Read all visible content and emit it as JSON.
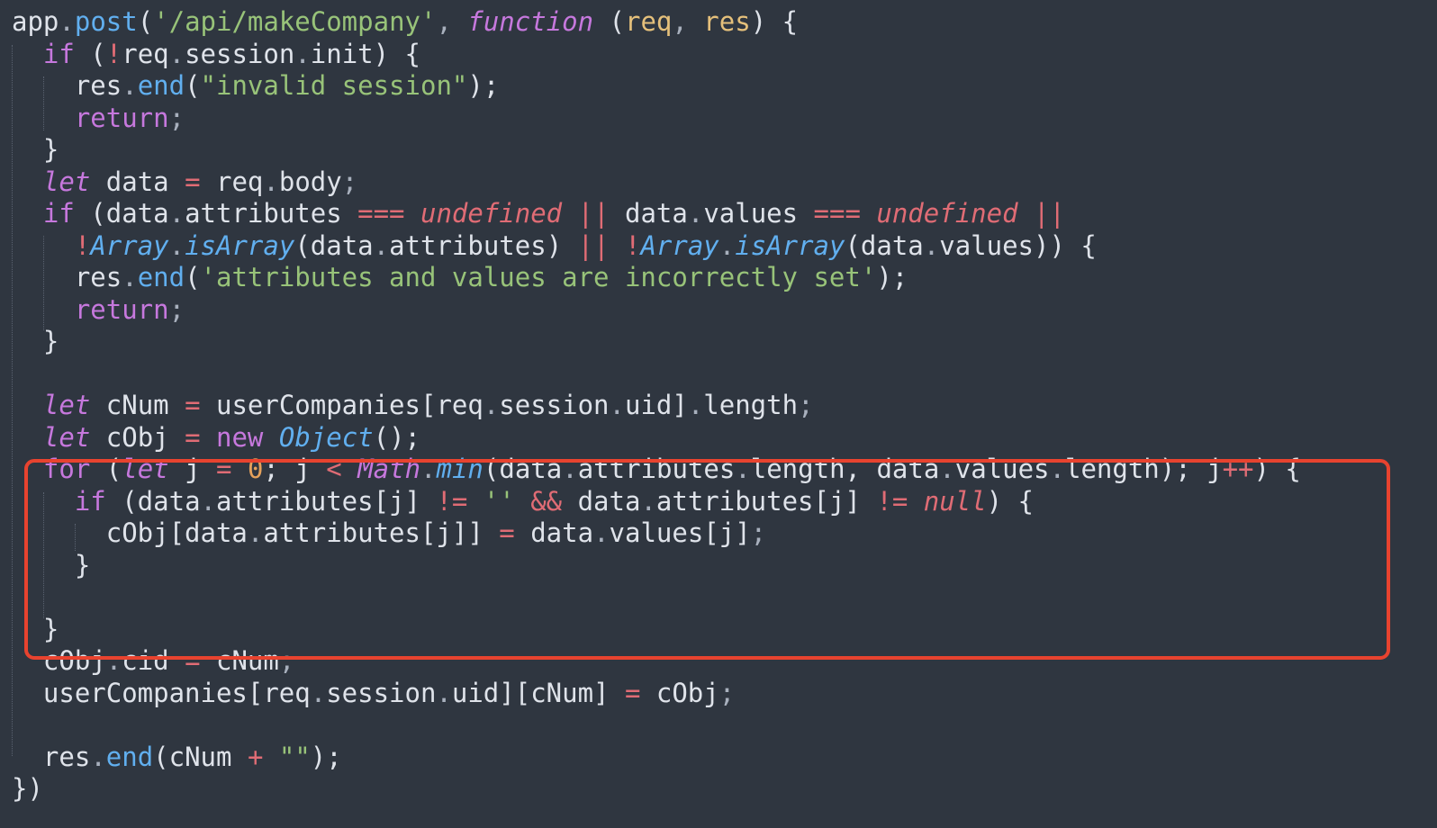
{
  "colors": {
    "background": "#2f3640",
    "plain": "#dfe3ea",
    "keyword": "#c678dd",
    "function": "#61afef",
    "string": "#98c379",
    "operator": "#e06c75",
    "param": "#e5c07b",
    "number": "#e5a15b",
    "punct": "#a8b0bd",
    "highlight_border": "#e8432f"
  },
  "code": {
    "lines": [
      [
        {
          "t": "app",
          "c": "plain"
        },
        {
          "t": ".",
          "c": "punct"
        },
        {
          "t": "post",
          "c": "function"
        },
        {
          "t": "(",
          "c": "plain"
        },
        {
          "t": "'/api/makeCompany'",
          "c": "string"
        },
        {
          "t": ", ",
          "c": "punct"
        },
        {
          "t": "function",
          "c": "keyword",
          "i": true
        },
        {
          "t": " (",
          "c": "plain"
        },
        {
          "t": "req",
          "c": "param"
        },
        {
          "t": ", ",
          "c": "punct"
        },
        {
          "t": "res",
          "c": "param"
        },
        {
          "t": ") {",
          "c": "plain"
        }
      ],
      [
        {
          "t": "  ",
          "c": "plain"
        },
        {
          "t": "if",
          "c": "keyword"
        },
        {
          "t": " (",
          "c": "plain"
        },
        {
          "t": "!",
          "c": "operator"
        },
        {
          "t": "req",
          "c": "plain"
        },
        {
          "t": ".",
          "c": "punct"
        },
        {
          "t": "session",
          "c": "plain"
        },
        {
          "t": ".",
          "c": "punct"
        },
        {
          "t": "init",
          "c": "plain"
        },
        {
          "t": ") {",
          "c": "plain"
        }
      ],
      [
        {
          "t": "    res",
          "c": "plain"
        },
        {
          "t": ".",
          "c": "punct"
        },
        {
          "t": "end",
          "c": "function"
        },
        {
          "t": "(",
          "c": "plain"
        },
        {
          "t": "\"invalid session\"",
          "c": "string"
        },
        {
          "t": ");",
          "c": "plain"
        }
      ],
      [
        {
          "t": "    ",
          "c": "plain"
        },
        {
          "t": "return",
          "c": "keyword"
        },
        {
          "t": ";",
          "c": "punct"
        }
      ],
      [
        {
          "t": "  }",
          "c": "plain"
        }
      ],
      [
        {
          "t": "  ",
          "c": "plain"
        },
        {
          "t": "let",
          "c": "keyword",
          "i": true
        },
        {
          "t": " data ",
          "c": "plain"
        },
        {
          "t": "=",
          "c": "operator"
        },
        {
          "t": " req",
          "c": "plain"
        },
        {
          "t": ".",
          "c": "punct"
        },
        {
          "t": "body",
          "c": "plain"
        },
        {
          "t": ";",
          "c": "punct"
        }
      ],
      [
        {
          "t": "  ",
          "c": "plain"
        },
        {
          "t": "if",
          "c": "keyword"
        },
        {
          "t": " (data",
          "c": "plain"
        },
        {
          "t": ".",
          "c": "punct"
        },
        {
          "t": "attributes ",
          "c": "plain"
        },
        {
          "t": "===",
          "c": "operator"
        },
        {
          "t": " ",
          "c": "plain"
        },
        {
          "t": "undefined",
          "c": "operator",
          "i": true
        },
        {
          "t": " ",
          "c": "plain"
        },
        {
          "t": "||",
          "c": "operator"
        },
        {
          "t": " data",
          "c": "plain"
        },
        {
          "t": ".",
          "c": "punct"
        },
        {
          "t": "values ",
          "c": "plain"
        },
        {
          "t": "===",
          "c": "operator"
        },
        {
          "t": " ",
          "c": "plain"
        },
        {
          "t": "undefined",
          "c": "operator",
          "i": true
        },
        {
          "t": " ",
          "c": "plain"
        },
        {
          "t": "||",
          "c": "operator"
        }
      ],
      [
        {
          "t": "    ",
          "c": "plain"
        },
        {
          "t": "!",
          "c": "operator"
        },
        {
          "t": "Array",
          "c": "function",
          "i": true
        },
        {
          "t": ".",
          "c": "punct"
        },
        {
          "t": "isArray",
          "c": "function",
          "i": true
        },
        {
          "t": "(data",
          "c": "plain"
        },
        {
          "t": ".",
          "c": "punct"
        },
        {
          "t": "attributes) ",
          "c": "plain"
        },
        {
          "t": "||",
          "c": "operator"
        },
        {
          "t": " ",
          "c": "plain"
        },
        {
          "t": "!",
          "c": "operator"
        },
        {
          "t": "Array",
          "c": "function",
          "i": true
        },
        {
          "t": ".",
          "c": "punct"
        },
        {
          "t": "isArray",
          "c": "function",
          "i": true
        },
        {
          "t": "(data",
          "c": "plain"
        },
        {
          "t": ".",
          "c": "punct"
        },
        {
          "t": "values)) {",
          "c": "plain"
        }
      ],
      [
        {
          "t": "    res",
          "c": "plain"
        },
        {
          "t": ".",
          "c": "punct"
        },
        {
          "t": "end",
          "c": "function"
        },
        {
          "t": "(",
          "c": "plain"
        },
        {
          "t": "'attributes and values are incorrectly set'",
          "c": "string"
        },
        {
          "t": ");",
          "c": "plain"
        }
      ],
      [
        {
          "t": "    ",
          "c": "plain"
        },
        {
          "t": "return",
          "c": "keyword"
        },
        {
          "t": ";",
          "c": "punct"
        }
      ],
      [
        {
          "t": "  }",
          "c": "plain"
        }
      ],
      [],
      [
        {
          "t": "  ",
          "c": "plain"
        },
        {
          "t": "let",
          "c": "keyword",
          "i": true
        },
        {
          "t": " cNum ",
          "c": "plain"
        },
        {
          "t": "=",
          "c": "operator"
        },
        {
          "t": " userCompanies[req",
          "c": "plain"
        },
        {
          "t": ".",
          "c": "punct"
        },
        {
          "t": "session",
          "c": "plain"
        },
        {
          "t": ".",
          "c": "punct"
        },
        {
          "t": "uid]",
          "c": "plain"
        },
        {
          "t": ".",
          "c": "punct"
        },
        {
          "t": "length",
          "c": "plain"
        },
        {
          "t": ";",
          "c": "punct"
        }
      ],
      [
        {
          "t": "  ",
          "c": "plain"
        },
        {
          "t": "let",
          "c": "keyword",
          "i": true
        },
        {
          "t": " cObj ",
          "c": "plain"
        },
        {
          "t": "=",
          "c": "operator"
        },
        {
          "t": " ",
          "c": "plain"
        },
        {
          "t": "new",
          "c": "keyword"
        },
        {
          "t": " ",
          "c": "plain"
        },
        {
          "t": "Object",
          "c": "function",
          "i": true
        },
        {
          "t": "();",
          "c": "plain"
        }
      ],
      [
        {
          "t": "  ",
          "c": "plain"
        },
        {
          "t": "for",
          "c": "keyword"
        },
        {
          "t": " (",
          "c": "plain"
        },
        {
          "t": "let",
          "c": "keyword",
          "i": true
        },
        {
          "t": " j ",
          "c": "plain"
        },
        {
          "t": "=",
          "c": "operator"
        },
        {
          "t": " ",
          "c": "plain"
        },
        {
          "t": "0",
          "c": "number"
        },
        {
          "t": "; j ",
          "c": "plain"
        },
        {
          "t": "<",
          "c": "operator"
        },
        {
          "t": " ",
          "c": "plain"
        },
        {
          "t": "Math",
          "c": "keyword",
          "i": true
        },
        {
          "t": ".",
          "c": "punct"
        },
        {
          "t": "min",
          "c": "function",
          "i": true
        },
        {
          "t": "(data",
          "c": "plain"
        },
        {
          "t": ".",
          "c": "punct"
        },
        {
          "t": "attributes",
          "c": "plain"
        },
        {
          "t": ".",
          "c": "punct"
        },
        {
          "t": "length, data",
          "c": "plain"
        },
        {
          "t": ".",
          "c": "punct"
        },
        {
          "t": "values",
          "c": "plain"
        },
        {
          "t": ".",
          "c": "punct"
        },
        {
          "t": "length); j",
          "c": "plain"
        },
        {
          "t": "++",
          "c": "operator"
        },
        {
          "t": ") {",
          "c": "plain"
        }
      ],
      [
        {
          "t": "    ",
          "c": "plain"
        },
        {
          "t": "if",
          "c": "keyword"
        },
        {
          "t": " (data",
          "c": "plain"
        },
        {
          "t": ".",
          "c": "punct"
        },
        {
          "t": "attributes[j] ",
          "c": "plain"
        },
        {
          "t": "!=",
          "c": "operator"
        },
        {
          "t": " ",
          "c": "plain"
        },
        {
          "t": "''",
          "c": "string"
        },
        {
          "t": " ",
          "c": "plain"
        },
        {
          "t": "&&",
          "c": "operator"
        },
        {
          "t": " data",
          "c": "plain"
        },
        {
          "t": ".",
          "c": "punct"
        },
        {
          "t": "attributes[j] ",
          "c": "plain"
        },
        {
          "t": "!=",
          "c": "operator"
        },
        {
          "t": " ",
          "c": "plain"
        },
        {
          "t": "null",
          "c": "operator",
          "i": true
        },
        {
          "t": ") {",
          "c": "plain"
        }
      ],
      [
        {
          "t": "      cObj[data",
          "c": "plain"
        },
        {
          "t": ".",
          "c": "punct"
        },
        {
          "t": "attributes[j]] ",
          "c": "plain"
        },
        {
          "t": "=",
          "c": "operator"
        },
        {
          "t": " data",
          "c": "plain"
        },
        {
          "t": ".",
          "c": "punct"
        },
        {
          "t": "values[j]",
          "c": "plain"
        },
        {
          "t": ";",
          "c": "punct"
        }
      ],
      [
        {
          "t": "    }",
          "c": "plain"
        }
      ],
      [],
      [
        {
          "t": "  }",
          "c": "plain"
        }
      ],
      [
        {
          "t": "  cObj",
          "c": "plain"
        },
        {
          "t": ".",
          "c": "punct"
        },
        {
          "t": "cid ",
          "c": "plain"
        },
        {
          "t": "=",
          "c": "operator"
        },
        {
          "t": " cNum",
          "c": "plain"
        },
        {
          "t": ";",
          "c": "punct"
        }
      ],
      [
        {
          "t": "  userCompanies[req",
          "c": "plain"
        },
        {
          "t": ".",
          "c": "punct"
        },
        {
          "t": "session",
          "c": "plain"
        },
        {
          "t": ".",
          "c": "punct"
        },
        {
          "t": "uid][cNum] ",
          "c": "plain"
        },
        {
          "t": "=",
          "c": "operator"
        },
        {
          "t": " cObj",
          "c": "plain"
        },
        {
          "t": ";",
          "c": "punct"
        }
      ],
      [],
      [
        {
          "t": "  res",
          "c": "plain"
        },
        {
          "t": ".",
          "c": "punct"
        },
        {
          "t": "end",
          "c": "function"
        },
        {
          "t": "(cNum ",
          "c": "plain"
        },
        {
          "t": "+",
          "c": "operator"
        },
        {
          "t": " ",
          "c": "plain"
        },
        {
          "t": "\"\"",
          "c": "string"
        },
        {
          "t": ");",
          "c": "plain"
        }
      ],
      [
        {
          "t": "})",
          "c": "plain"
        }
      ]
    ]
  }
}
